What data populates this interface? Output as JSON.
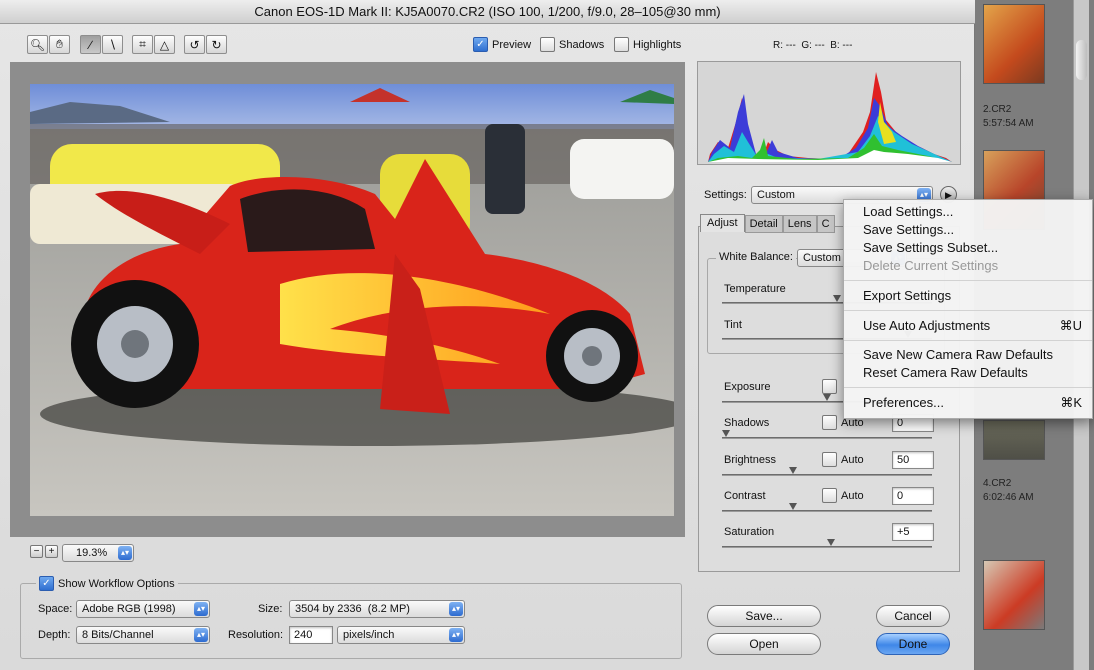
{
  "title": "Canon EOS-1D Mark II:  KJ5A0070.CR2  (ISO 100, 1/200, f/9.0, 28–105@30 mm)",
  "toolbar": {
    "tools": [
      "zoom-tool-icon",
      "hand-tool-icon",
      "white-balance-tool-icon",
      "color-sampler-tool-icon",
      "crop-tool-icon",
      "straighten-tool-icon",
      "rotate-left-icon",
      "rotate-right-icon"
    ],
    "preview_label": "Preview",
    "shadows_label": "Shadows",
    "highlights_label": "Highlights",
    "rgb_readout": "R: ---  G: ---  B: ---"
  },
  "zoom": {
    "value": "19.3%"
  },
  "workflow": {
    "show_label": "Show Workflow Options",
    "space_label": "Space:",
    "space_value": "Adobe RGB (1998)",
    "depth_label": "Depth:",
    "depth_value": "8 Bits/Channel",
    "size_label": "Size:",
    "size_value": "3504 by 2336  (8.2 MP)",
    "resolution_label": "Resolution:",
    "resolution_value": "240",
    "resolution_unit": "pixels/inch"
  },
  "settings": {
    "label": "Settings:",
    "value": "Custom",
    "tabs": [
      "Adjust",
      "Detail",
      "Lens",
      "C"
    ]
  },
  "adjust": {
    "wb_label": "White Balance:",
    "wb_value": "Custom",
    "temperature_label": "Temperature",
    "tint_label": "Tint",
    "temperature_level": 0.55,
    "tint_level": 0.9,
    "auto_label": "Auto",
    "exposure_label": "Exposure",
    "exposure_level": 0.5,
    "shadows_label": "Shadows",
    "shadows_value": "0",
    "shadows_level": 0.0,
    "brightness_label": "Brightness",
    "brightness_value": "50",
    "brightness_level": 0.33,
    "contrast_label": "Contrast",
    "contrast_value": "0",
    "contrast_level": 0.33,
    "saturation_label": "Saturation",
    "saturation_value": "+5",
    "saturation_level": 0.52
  },
  "menu": {
    "items": [
      {
        "label": "Load Settings..."
      },
      {
        "label": "Save Settings..."
      },
      {
        "label": "Save Settings Subset..."
      },
      {
        "label": "Delete Current Settings"
      },
      {
        "label": "Export Settings"
      },
      {
        "label": "Use Auto Adjustments",
        "shortcut": "⌘U"
      },
      {
        "label": "Save New Camera Raw Defaults"
      },
      {
        "label": "Reset Camera Raw Defaults"
      },
      {
        "label": "Preferences...",
        "shortcut": "⌘K"
      }
    ]
  },
  "buttons": {
    "save": "Save...",
    "open": "Open",
    "cancel": "Cancel",
    "done": "Done"
  },
  "background": {
    "file1_name": "2.CR2",
    "file1_time": "5:57:54 AM",
    "file2_name": "4.CR2",
    "file2_time": "6:02:46 AM"
  },
  "colors": {
    "accent": "#3f87e8",
    "canvas_bg": "#8d8d8d"
  }
}
